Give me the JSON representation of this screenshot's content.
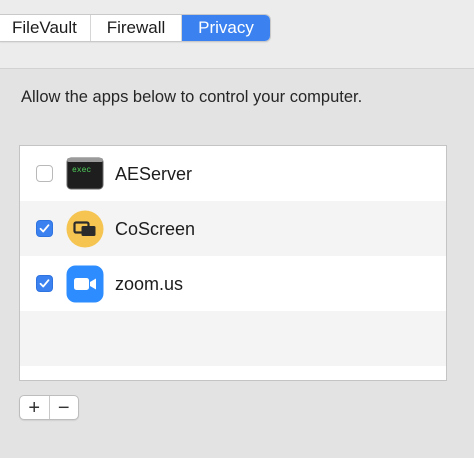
{
  "tabs": [
    {
      "label": "FileVault",
      "active": false
    },
    {
      "label": "Firewall",
      "active": false
    },
    {
      "label": "Privacy",
      "active": true
    }
  ],
  "instruction": "Allow the apps below to control your computer.",
  "apps": [
    {
      "name": "AEServer",
      "checked": false,
      "icon": "terminal-exec-icon",
      "icon_text": "exec"
    },
    {
      "name": "CoScreen",
      "checked": true,
      "icon": "coscreen-icon"
    },
    {
      "name": "zoom.us",
      "checked": true,
      "icon": "zoom-camera-icon"
    }
  ],
  "controls": {
    "add": "+",
    "remove": "−"
  },
  "colors": {
    "accent": "#3b82f0",
    "coscreen": "#f5c451",
    "zoom": "#2d8cff",
    "terminal": "#1e1e1e"
  }
}
